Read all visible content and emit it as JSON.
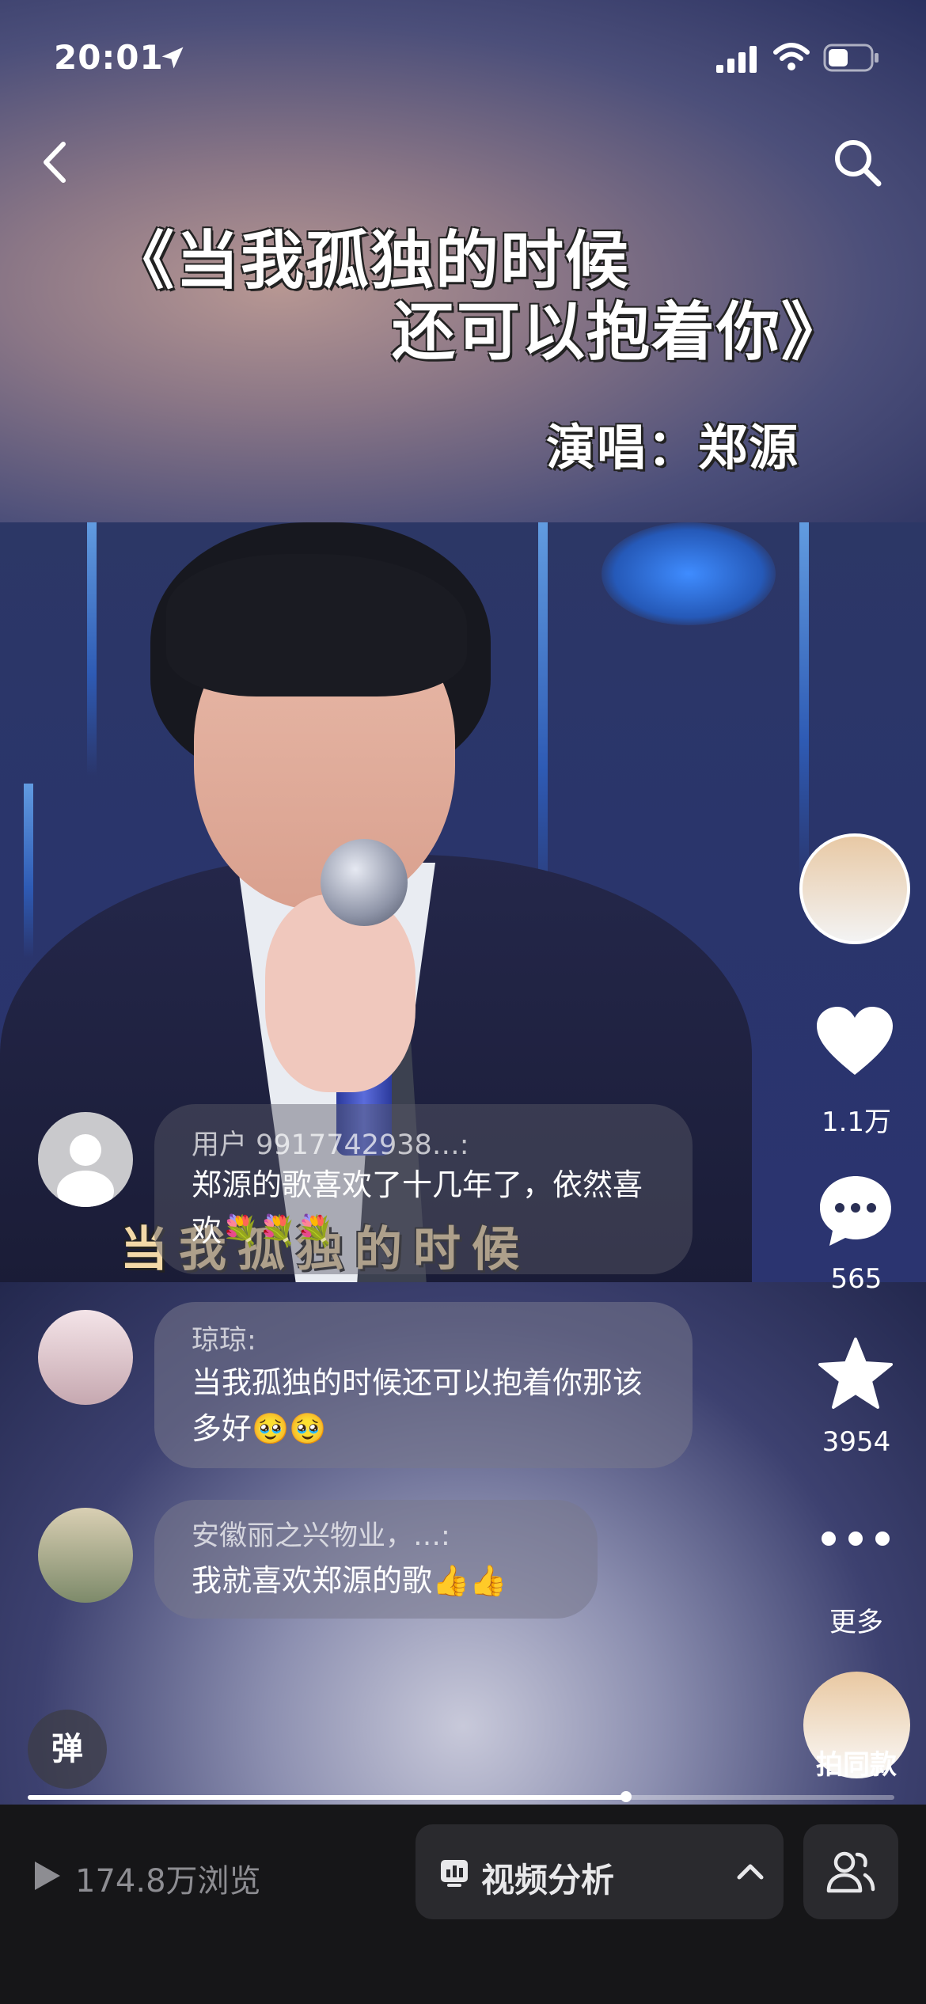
{
  "status_bar": {
    "time": "20:01"
  },
  "video": {
    "title_line1": "《当我孤独的时候",
    "title_line2": "还可以抱着你》",
    "singer_credit": "演唱：郑源",
    "lyric_overlay": "当我孤独的时候"
  },
  "comments": [
    {
      "user": "用户 9917742938…:",
      "text": "郑源的歌喜欢了十几年了，依然喜欢💐💐💐"
    },
    {
      "user": "琼琼:",
      "text": "当我孤独的时候还可以抱着你那该多好🥹🥹"
    },
    {
      "user": "安徽丽之兴物业，…:",
      "text": "我就喜欢郑源的歌👍👍"
    }
  ],
  "right_rail": {
    "like_count": "1.1万",
    "comment_count": "565",
    "favorite_count": "3954",
    "more_label": "更多",
    "same_style_label": "拍同款"
  },
  "danmaku_label": "弹",
  "progress": {
    "fraction": 0.69
  },
  "bottom_bar": {
    "views": "174.8万浏览",
    "analysis_label": "视频分析"
  },
  "icons": [
    "location-arrow-icon",
    "signal-icon",
    "wifi-icon",
    "battery-icon",
    "back-icon",
    "search-icon",
    "heart-icon",
    "comment-icon",
    "star-icon",
    "more-icon",
    "play-icon",
    "analysis-icon",
    "chevron-up-icon",
    "friends-icon"
  ]
}
